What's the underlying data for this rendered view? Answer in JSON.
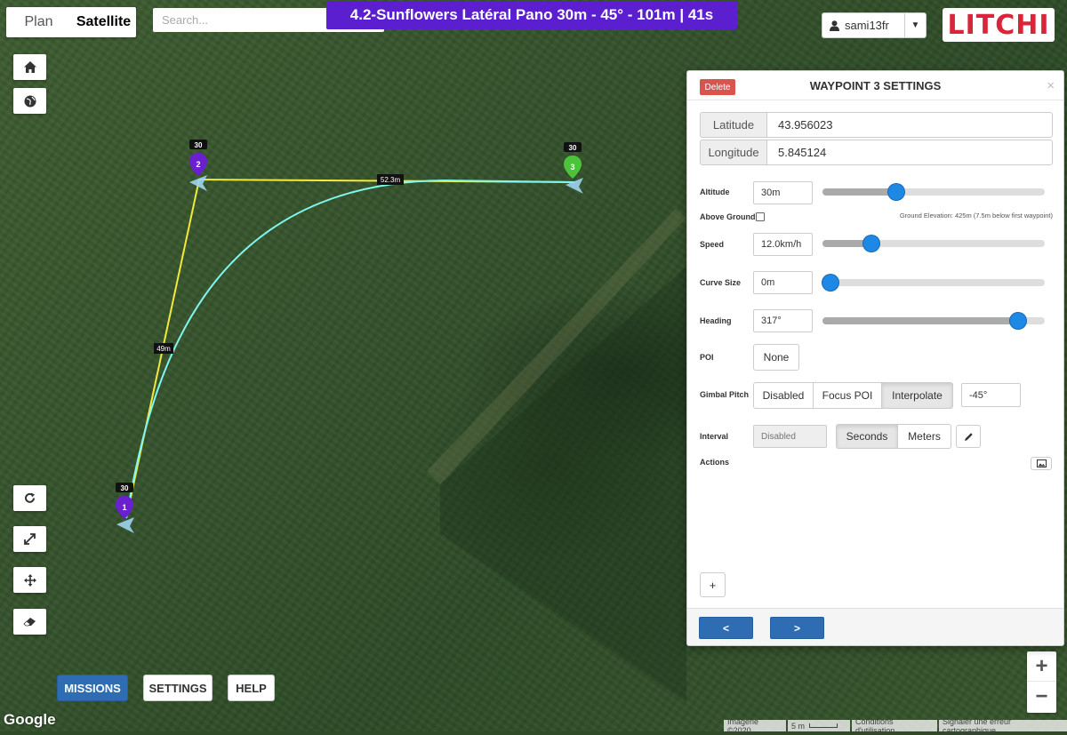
{
  "map_type": {
    "plan": "Plan",
    "satellite": "Satellite",
    "selected": "Satellite"
  },
  "search": {
    "placeholder": "Search..."
  },
  "mission": {
    "title": "4.2-Sunflowers Latéral Pano 30m - 45° - 101m | 41s"
  },
  "user": {
    "name": "sami13fr"
  },
  "logo": {
    "text": "LITCHI"
  },
  "waypoints": [
    {
      "number": "1",
      "altitude_badge": "30",
      "color": "#6a1fd0"
    },
    {
      "number": "2",
      "altitude_badge": "30",
      "color": "#6a1fd0"
    },
    {
      "number": "3",
      "altitude_badge": "30",
      "color": "#4cc43a"
    }
  ],
  "segments": {
    "wp1_wp2": "49m",
    "wp2_wp3": "52.3m"
  },
  "left_controls": [
    "home-icon",
    "globe-icon",
    "refresh-icon",
    "expand-icon",
    "move-icon",
    "eraser-icon"
  ],
  "bottom_nav": {
    "missions": "MISSIONS",
    "settings": "SETTINGS",
    "help": "HELP"
  },
  "map_footer": {
    "google": "Google",
    "imagery": "Imagerie ©2020",
    "scale": "5 m",
    "terms": "Conditions d'utilisation",
    "report": "Signaler une erreur cartographique"
  },
  "zoom": {
    "in": "+",
    "out": "−"
  },
  "panel": {
    "delete_label": "Delete",
    "title": "WAYPOINT 3 SETTINGS",
    "close": "×",
    "latitude_label": "Latitude",
    "latitude": "43.956023",
    "longitude_label": "Longitude",
    "longitude": "5.845124",
    "altitude_label": "Altitude",
    "altitude": "30m",
    "above_ground_label": "Above Ground",
    "above_ground_checked": false,
    "ground_elevation": "Ground Elevation: 425m (7.5m below first waypoint)",
    "speed_label": "Speed",
    "speed": "12.0km/h",
    "curve_label": "Curve Size",
    "curve": "0m",
    "heading_label": "Heading",
    "heading": "317°",
    "poi_label": "POI",
    "poi_value": "None",
    "gimbal_label": "Gimbal Pitch",
    "gimbal_options": [
      "Disabled",
      "Focus POI",
      "Interpolate"
    ],
    "gimbal_selected": "Interpolate",
    "gimbal_value": "-45°",
    "interval_label": "Interval",
    "interval_value": "Disabled",
    "interval_units": [
      "Seconds",
      "Meters"
    ],
    "interval_selected": "Seconds",
    "actions_label": "Actions",
    "add_action": "+",
    "prev": "<",
    "next": ">",
    "slider_levels": {
      "altitude": 0.33,
      "speed": 0.22,
      "curve": 0.0,
      "heading": 0.88
    }
  }
}
